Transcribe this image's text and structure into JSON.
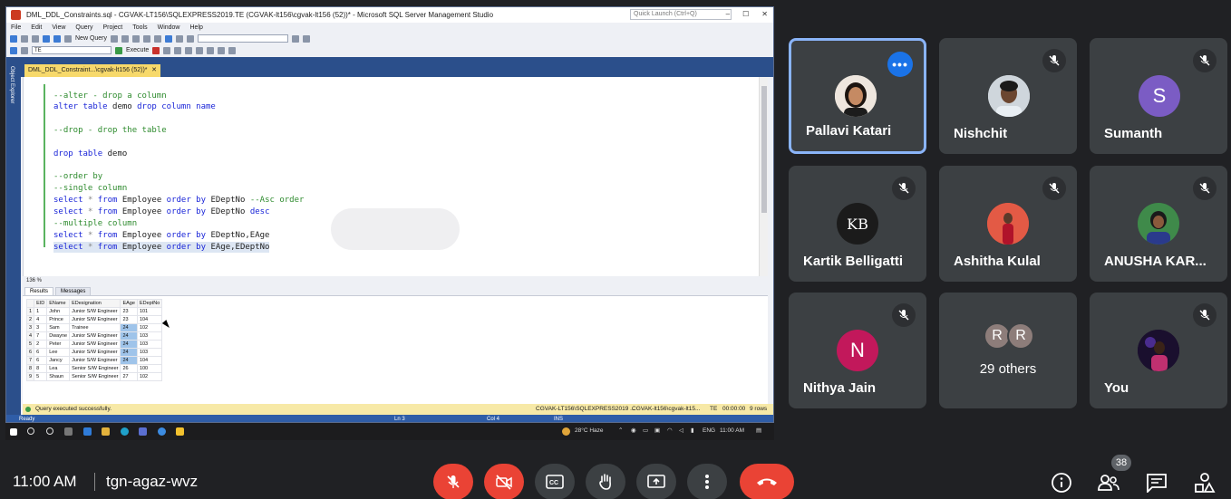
{
  "ssms": {
    "title": "DML_DDL_Constraints.sql - CGVAK-LT156\\SQLEXPRESS2019.TE (CGVAK-lt156\\cgvak-lt156 (52))* - Microsoft SQL Server Management Studio",
    "quick_launch": "Quick Launch (Ctrl+Q)",
    "menu": [
      "File",
      "Edit",
      "View",
      "Query",
      "Project",
      "Tools",
      "Window",
      "Help"
    ],
    "new_query": "New Query",
    "database": "TE",
    "execute": "Execute",
    "object_explorer": "Object Explorer",
    "doc_tab": "DML_DDL_Constraint...\\cgvak-lt156 (52))*",
    "doc_tab_close": "✕",
    "code": [
      "--alter - drop a column",
      "alter table demo drop column name",
      "--drop - drop the table",
      "drop table demo",
      "--order by",
      "--single column",
      "select * from Employee order by EDeptNo --Asc order",
      "select * from Employee order by EDeptNo desc",
      "--multiple column",
      "select * from Employee order by EDeptNo,EAge",
      "select * from Employee order by EAge,EDeptNo"
    ],
    "zoom": "136 %",
    "results_tab": "Results",
    "messages_tab": "Messages",
    "columns": [
      "EID",
      "EName",
      "EDesignation",
      "EAge",
      "EDeptNo"
    ],
    "rows": [
      [
        "1",
        "1",
        "John",
        "Junior S/W Engineer",
        "23",
        "101"
      ],
      [
        "2",
        "4",
        "Prince",
        "Junior S/W Engineer",
        "23",
        "104"
      ],
      [
        "3",
        "3",
        "Sam",
        "Trainee",
        "24",
        "102"
      ],
      [
        "4",
        "7",
        "Dwayne",
        "Junior S/W Engineer",
        "24",
        "103"
      ],
      [
        "5",
        "2",
        "Peter",
        "Junior S/W Engineer",
        "24",
        "103"
      ],
      [
        "6",
        "6",
        "Lee",
        "Junior S/W Engineer",
        "24",
        "103"
      ],
      [
        "7",
        "6",
        "Jancy",
        "Junior S/W Engineer",
        "24",
        "104"
      ],
      [
        "8",
        "8",
        "Lea",
        "Senior S/W Engineer",
        "26",
        "100"
      ],
      [
        "9",
        "5",
        "Shaun",
        "Senior S/W Engineer",
        "27",
        "102"
      ]
    ],
    "query_status": "Query executed successfully.",
    "server": "CGVAK-LT156\\SQLEXPRESS2019 ...",
    "user": "CGVAK-lt156\\cgvak-lt15...",
    "db_status": "TE",
    "elapsed": "00:00:00",
    "row_count": "9 rows",
    "statusbar": {
      "ready": "Ready",
      "ln": "Ln 3",
      "col": "Col 4",
      "ins": "INS"
    }
  },
  "taskbar": {
    "weather": "28°C  Haze",
    "lang": "ENG",
    "clock": "11:00 AM"
  },
  "participants": [
    {
      "name": "Pallavi Katari"
    },
    {
      "name": "Nishchit"
    },
    {
      "name": "Sumanth",
      "initial": "S",
      "color": "#7b5cc4"
    },
    {
      "name": "Kartik Belligatti",
      "initial": "KB"
    },
    {
      "name": "Ashitha Kulal"
    },
    {
      "name": "ANUSHA KAR..."
    },
    {
      "name": "Nithya Jain",
      "initial": "N",
      "color": "#c2185b"
    },
    {
      "name": "29 others",
      "initials": [
        "R",
        "R"
      ]
    },
    {
      "name": "You"
    }
  ],
  "meeting": {
    "time": "11:00 AM",
    "code": "tgn-agaz-wvz",
    "participant_count": "38",
    "more_glyph": "•••"
  }
}
